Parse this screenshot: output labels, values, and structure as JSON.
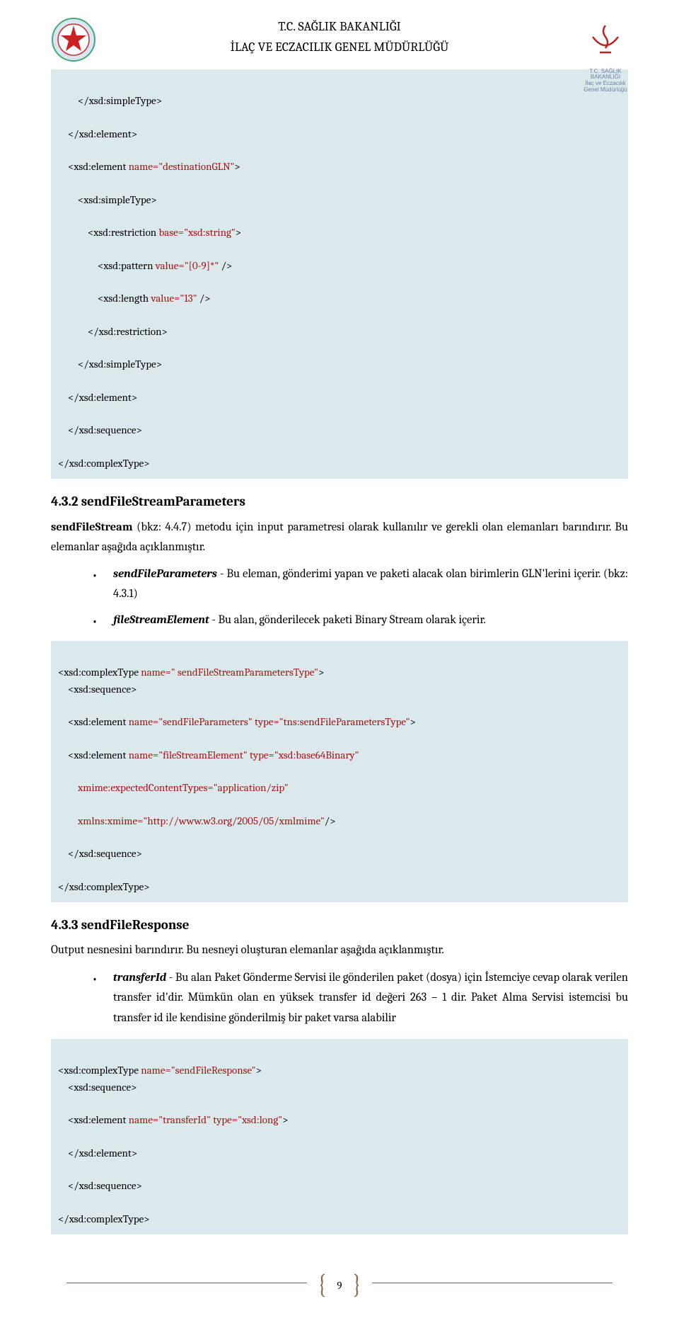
{
  "header": {
    "line1": "T.C. SAĞLIK BAKANLIĞI",
    "line2": "İLAÇ VE ECZACILIK GENEL MÜDÜRLÜĞÜ",
    "logo_right_sub1": "T.C. SAĞLIK BAKANLIĞI",
    "logo_right_sub2": "İlaç ve Eczacılık",
    "logo_right_sub3": "Genel Müdürlüğü"
  },
  "codeblock1": {
    "l1_open": "</xsd:simpleType>",
    "l2": "</xsd:element>",
    "l3_open": "<xsd:element ",
    "l3_attr": "name=\"destinationGLN\"",
    "l3_close": ">",
    "l4": "<xsd:simpleType>",
    "l5_open": "<xsd:restriction ",
    "l5_attr": "base=\"xsd:string\"",
    "l5_close": ">",
    "l6_open": "<xsd:pattern ",
    "l6_attr": "value=\"[0-9]*\"",
    "l6_close": " />",
    "l7_open": "<xsd:length ",
    "l7_attr": "value=\"13\"",
    "l7_close": " />",
    "l8": "</xsd:restriction>",
    "l9": "</xsd:simpleType>",
    "l10": "</xsd:element>",
    "l11": "</xsd:sequence>",
    "l12": "</xsd:complexType>"
  },
  "section_4_3_2": {
    "heading": "4.3.2    sendFileStreamParameters",
    "para_label": "sendFileStream",
    "para_text_1": " (bkz: 4.4.7) metodu için input parametresi olarak kullanılır ve gerekli olan elemanları barındırır. Bu elemanlar aşağıda açıklanmıştır.",
    "bullet1_label": "sendFileParameters",
    "bullet1_text": " - Bu eleman, gönderimi yapan ve paketi alacak olan birimlerin GLN'lerini içerir. (bkz: 4.3.1)",
    "bullet2_label": "fileStreamElement",
    "bullet2_text": " - Bu alan, gönderilecek paketi Binary Stream olarak içerir."
  },
  "codeblock2": {
    "l1_open": "<xsd:complexType ",
    "l1_attr": "name=\" sendFileStreamParametersType\"",
    "l1_close": ">",
    "l2": "<xsd:sequence>",
    "l3_open": "<xsd:element ",
    "l3_attr1": "name=\"sendFileParameters\"",
    "l3_mid": " ",
    "l3_attr2": "type=\"tns:sendFileParametersType\"",
    "l3_close": ">",
    "l4_open": "<xsd:element ",
    "l4_attr1": "name=\"fileStreamElement\"",
    "l4_mid": " ",
    "l4_attr2": "type=\"xsd:base64Binary\"",
    "l5_attr": "xmime:expectedContentTypes=\"application/zip\"",
    "l6_attr": "xmlns:xmime=\"http://www.w3.org/2005/05/xmlmime\"",
    "l6_close": "/>",
    "l7": "</xsd:sequence>",
    "l8": "</xsd:complexType>"
  },
  "section_4_3_3": {
    "heading": "4.3.3    sendFileResponse",
    "para1": "Output nesnesini barındırır.  Bu nesneyi oluşturan elemanlar aşağıda açıklanmıştır.",
    "bullet1_label": "transferId",
    "bullet1_text": " - Bu alan Paket Gönderme Servisi ile gönderilen paket (dosya) için İstemciye cevap olarak verilen transfer id'dir. Mümkün olan en yüksek transfer id değeri 263 – 1 dir. Paket Alma Servisi istemcisi bu transfer id ile kendisine gönderilmiş bir paket varsa alabilir"
  },
  "codeblock3": {
    "l1_open": "<xsd:complexType ",
    "l1_attr": "name=\"sendFileResponse\"",
    "l1_close": ">",
    "l2": "<xsd:sequence>",
    "l3_open": "<xsd:element ",
    "l3_attr1": "name=\"transferId\"",
    "l3_mid": " ",
    "l3_attr2": "type=\"xsd:long\"",
    "l3_close": ">",
    "l4": "</xsd:element>",
    "l5": "</xsd:sequence>",
    "l6": "</xsd:complexType>"
  },
  "page_number": "9"
}
